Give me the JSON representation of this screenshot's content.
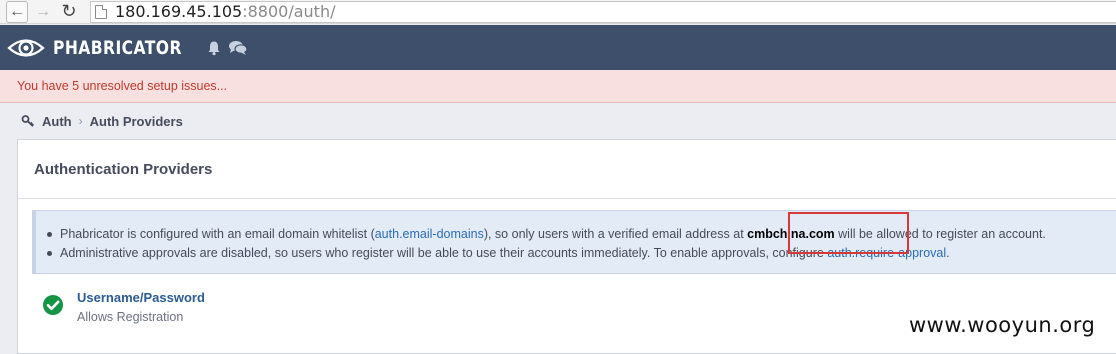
{
  "browser": {
    "url_host": "180.169.45.105",
    "url_rest": ":8800/auth/"
  },
  "header": {
    "brand": "PHABRICATOR"
  },
  "setup_banner": {
    "text": "You have 5 unresolved setup issues..."
  },
  "breadcrumbs": [
    {
      "label": "Auth"
    },
    {
      "label": "Auth Providers"
    }
  ],
  "panel": {
    "title": "Authentication Providers",
    "info": {
      "line1_prefix": "Phabricator is configured with an email domain whitelist (",
      "line1_link": "auth.email-domains",
      "line1_middle": "), so only users with a verified email address at ",
      "line1_domain": "cmbchina.com",
      "line1_suffix": " will be allowed to register an account.",
      "line2_prefix": "Administrative approvals are disabled, so users who register will be able to use their accounts immediately. To enable approvals, configure ",
      "line2_link": "auth.require-approval",
      "line2_suffix": "."
    },
    "provider": {
      "name": "Username/Password",
      "status": "Allows Registration"
    }
  },
  "watermark": "www.wooyun.org",
  "colors": {
    "header_bg": "#3d4f6a",
    "warning_text": "#c0392b",
    "link": "#2a6db4",
    "success": "#139543",
    "annotation": "#d9383a"
  }
}
